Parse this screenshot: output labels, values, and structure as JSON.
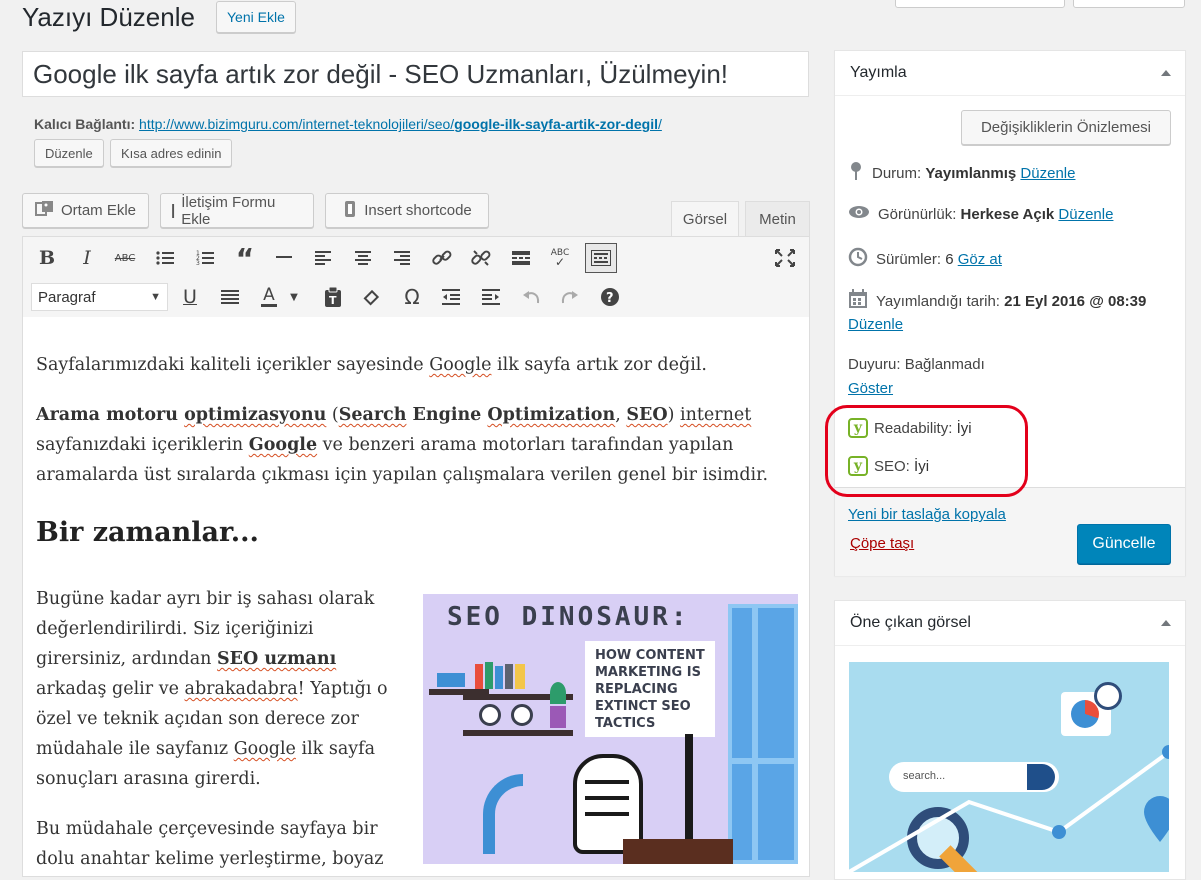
{
  "header": {
    "title": "Yazıyı Düzenle",
    "add_new": "Yeni Ekle"
  },
  "post": {
    "title": "Google ilk sayfa artık zor değil - SEO Uzmanları, Üzülmeyin!",
    "permalink_label": "Kalıcı Bağlantı:",
    "permalink_base": "http://www.bizimguru.com/internet-teknolojileri/seo/",
    "permalink_slug": "google-ilk-sayfa-artik-zor-degil",
    "permalink_end": "/",
    "edit_button": "Düzenle",
    "shortlink_button": "Kısa adres edinin"
  },
  "media_buttons": {
    "add_media": "Ortam Ekle",
    "contact_form": "İletişim Formu Ekle",
    "shortcode": "Insert shortcode"
  },
  "editor_tabs": {
    "visual": "Görsel",
    "text": "Metin"
  },
  "toolbar": {
    "format_select": "Paragraf"
  },
  "content": {
    "p1_a": "Sayfalarımızdaki kaliteli içerikler sayesinde ",
    "p1_b": "Google",
    "p1_c": " ilk sayfa artık zor değil.",
    "p2_a": "Arama motoru ",
    "p2_b": "optimizasyonu",
    "p2_c": " (",
    "p2_d": "Search",
    "p2_e": " Engine ",
    "p2_f": "Optimization",
    "p2_g": ", ",
    "p2_h": "SEO",
    "p2_i": ") ",
    "p2_j": "internet",
    "p2_k": "sayfanızdaki içeriklerin ",
    "p2_l": "Google",
    "p2_m": " ve benzeri arama motorları tarafından yapılan",
    "p2_n": "aramalarda üst sıralarda çıkması için yapılan çalışmalara verilen genel bir isimdir.",
    "h2": "Bir zamanlar...",
    "p3_1": "Bugüne kadar ayrı bir iş sahası olarak",
    "p3_2": "değerlendirilirdi. Siz içeriğinizi",
    "p3_3": "girersiniz, ardından ",
    "p3_3b": "SEO uzmanı",
    "p3_4a": "arkadaş gelir ve ",
    "p3_4b": "abrakadabra",
    "p3_4c": "! Yaptığı o",
    "p3_5": "özel ve teknik açıdan son derece zor",
    "p3_6a": "müdahale ile sayfanız ",
    "p3_6b": "Google",
    "p3_6c": " ilk sayfa",
    "p3_7": "sonuçları arasına girerdi.",
    "p4_1": "Bu müdahale çerçevesinde sayfaya bir",
    "p4_2": "dolu anahtar kelime yerleştirme, boyaz",
    "image": {
      "line1": "SEO DINOSAUR:",
      "box1": "HOW CONTENT",
      "box2": "MARKETING IS",
      "box3": "REPLACING",
      "box4": "EXTINCT SEO",
      "box5": "TACTICS"
    }
  },
  "publish": {
    "title": "Yayımla",
    "preview": "Değişikliklerin Önizlemesi",
    "status_label": "Durum:",
    "status_value": "Yayımlanmış",
    "status_edit": "Düzenle",
    "visibility_label": "Görünürlük:",
    "visibility_value": "Herkese Açık",
    "visibility_edit": "Düzenle",
    "revisions_label": "Sürümler:",
    "revisions_value": "6",
    "revisions_link": "Göz at",
    "date_label": "Yayımlandığı tarih:",
    "date_value": "21 Eyl 2016 @ 08:39",
    "date_edit": "Düzenle",
    "notice_label": "Duyuru: Bağlanmadı",
    "notice_link": "Göster",
    "readability_label": "Readability:",
    "readability_value": "İyi",
    "seo_label": "SEO:",
    "seo_value": "İyi",
    "copy_draft": "Yeni bir taslağa kopyala",
    "trash": "Çöpe taşı",
    "update": "Güncelle"
  },
  "featured": {
    "title": "Öne çıkan görsel",
    "search_text": "search..."
  },
  "colors": {
    "primary": "#0085ba",
    "link": "#0073aa",
    "yoast_green": "#77b227",
    "highlight_red": "#e3001b",
    "trash_red": "#a00"
  }
}
